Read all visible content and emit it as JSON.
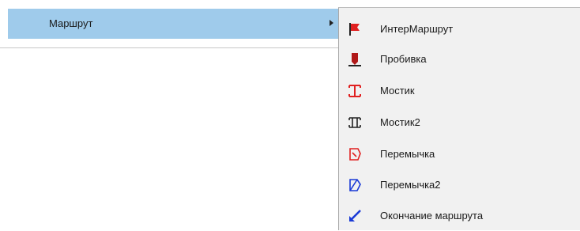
{
  "parent_menu": {
    "item_label": "Маршрут"
  },
  "submenu": {
    "items": [
      {
        "label": "ИнтерМаршрут",
        "icon": "red-flag-icon"
      },
      {
        "label": "Пробивка",
        "icon": "pierce-icon"
      },
      {
        "label": "Мостик",
        "icon": "bridge-red-icon"
      },
      {
        "label": "Мостик2",
        "icon": "bridge-black-icon"
      },
      {
        "label": "Перемычка",
        "icon": "jumper-red-icon"
      },
      {
        "label": "Перемычка2",
        "icon": "jumper-blue-icon"
      },
      {
        "label": "Окончание маршрута",
        "icon": "checkmark-icon"
      }
    ]
  },
  "colors": {
    "highlight": "#9fcbeb",
    "submenu_bg": "#f1f1f1",
    "red": "#e02020",
    "blue": "#1a3ad6"
  }
}
